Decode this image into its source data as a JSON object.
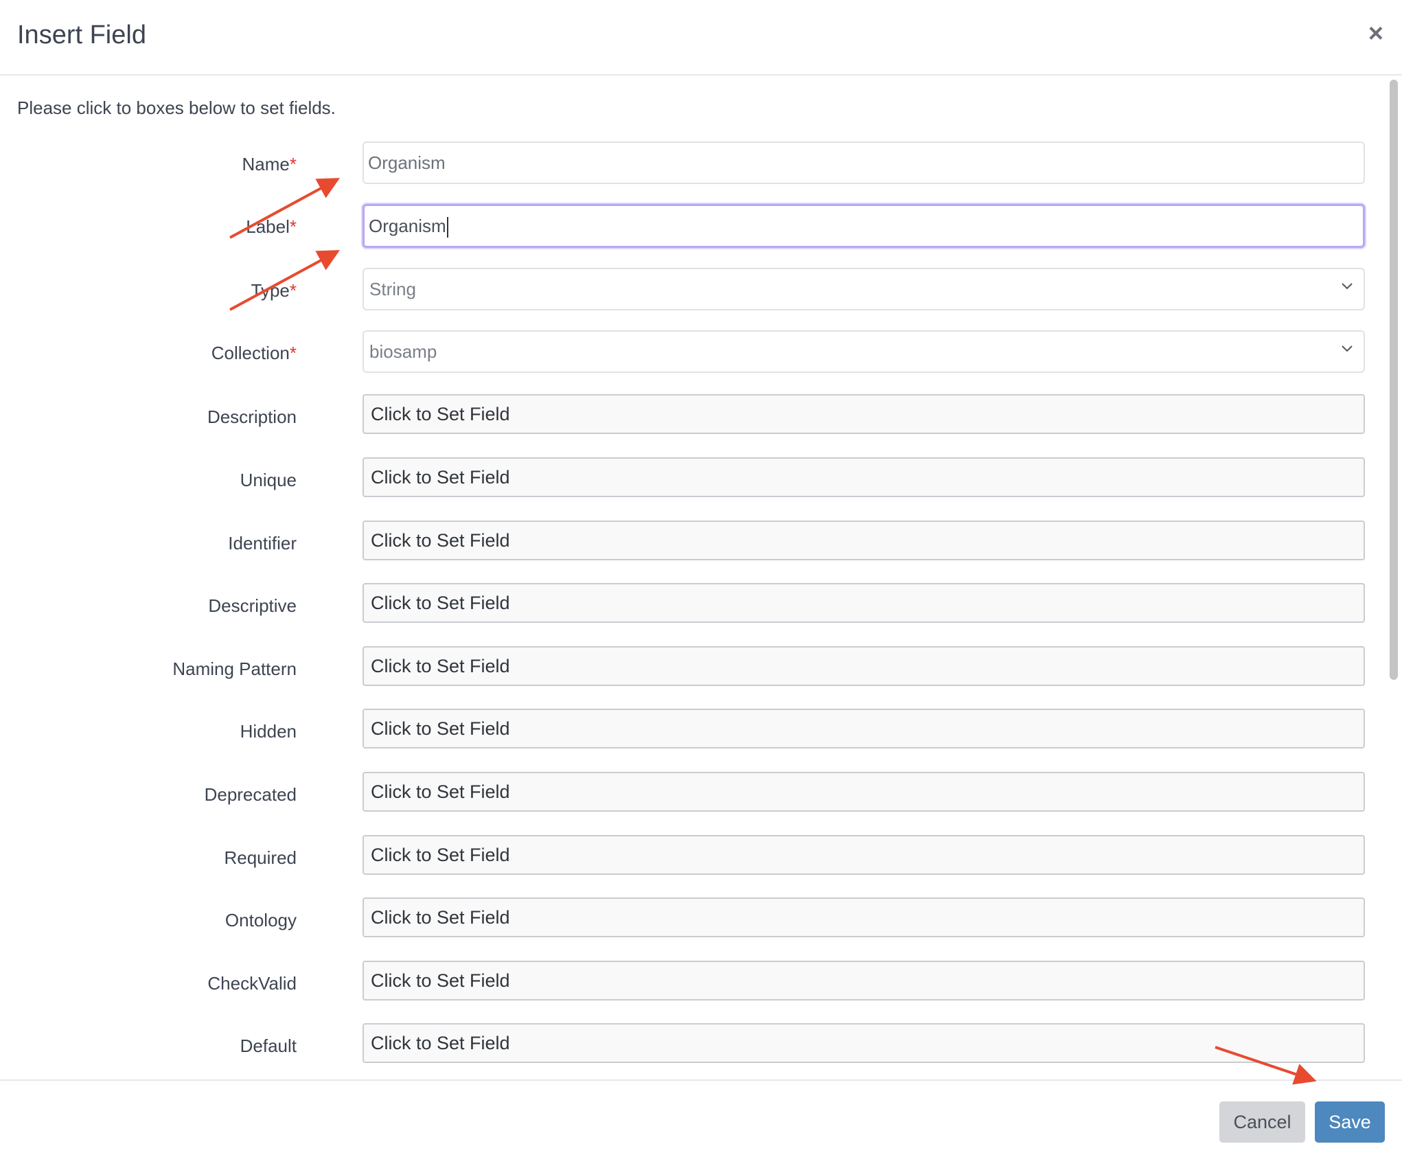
{
  "dialog": {
    "title": "Insert Field",
    "close_icon": "×"
  },
  "intro_text": "Please click to boxes below to set fields.",
  "required_mark": "*",
  "fields": {
    "name": {
      "label": "Name",
      "value": "Organism"
    },
    "label": {
      "label": "Label",
      "value": "Organism"
    },
    "type": {
      "label": "Type",
      "value": "String"
    },
    "collection": {
      "label": "Collection",
      "value": "biosamp"
    }
  },
  "optional_fields": [
    {
      "label": "Description",
      "value": "Click to Set Field"
    },
    {
      "label": "Unique",
      "value": "Click to Set Field"
    },
    {
      "label": "Identifier",
      "value": "Click to Set Field"
    },
    {
      "label": "Descriptive",
      "value": "Click to Set Field"
    },
    {
      "label": "Naming Pattern",
      "value": "Click to Set Field"
    },
    {
      "label": "Hidden",
      "value": "Click to Set Field"
    },
    {
      "label": "Deprecated",
      "value": "Click to Set Field"
    },
    {
      "label": "Required",
      "value": "Click to Set Field"
    },
    {
      "label": "Ontology",
      "value": "Click to Set Field"
    },
    {
      "label": "CheckValid",
      "value": "Click to Set Field"
    },
    {
      "label": "Default",
      "value": "Click to Set Field"
    }
  ],
  "footer": {
    "cancel_label": "Cancel",
    "save_label": "Save"
  },
  "colors": {
    "primary": "#4d88be",
    "required": "#e0362d",
    "annotation_arrow": "#e84a2f",
    "focus_ring": "#b9a7f2"
  }
}
